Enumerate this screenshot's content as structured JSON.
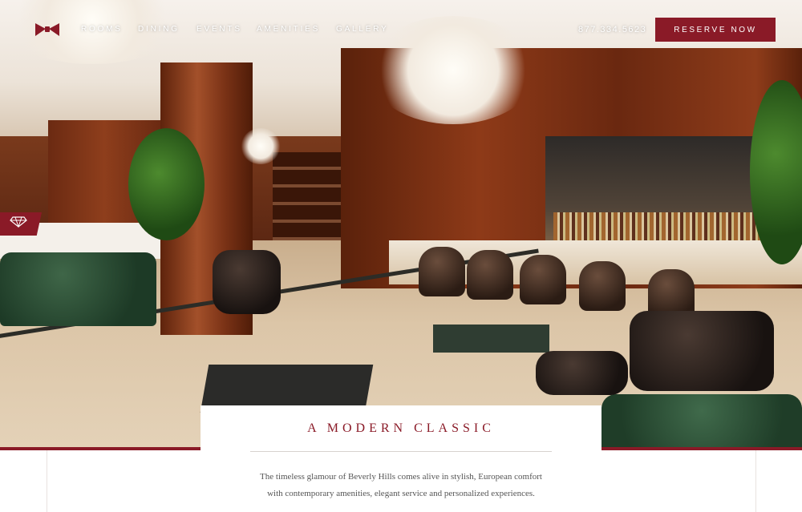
{
  "nav": {
    "items": [
      {
        "label": "ROOMS"
      },
      {
        "label": "DINING"
      },
      {
        "label": "EVENTS"
      },
      {
        "label": "AMENITIES"
      },
      {
        "label": "GALLERY"
      }
    ],
    "phone": "877.334.5623",
    "reserve_label": "RESERVE NOW"
  },
  "hero": {
    "image": "hotel-lobby-bar-photo"
  },
  "side_tab": {
    "icon": "diamond-icon"
  },
  "intro": {
    "heading": "A MODERN CLASSIC",
    "text_line1": "The timeless glamour of Beverly Hills comes alive in stylish, European comfort",
    "text_line2": "with contemporary amenities, elegant service and personalized experiences."
  },
  "colors": {
    "brand": "#8a1a27",
    "text": "#555555"
  }
}
